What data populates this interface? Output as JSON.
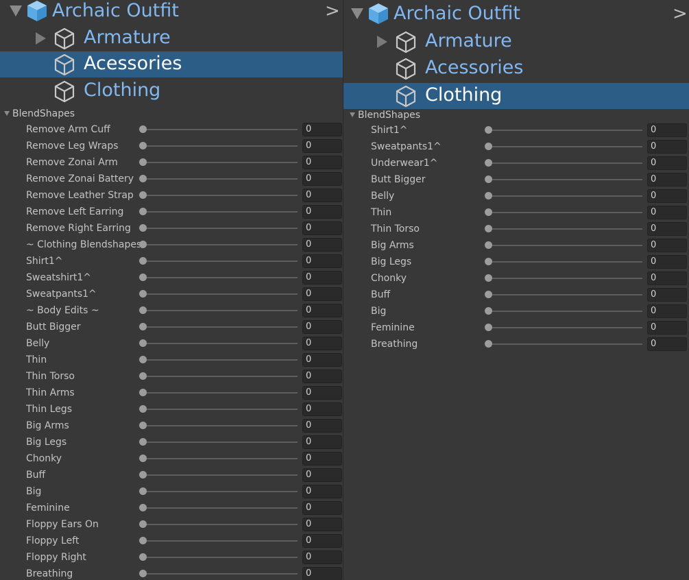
{
  "icon": {
    "cube": "cube-icon",
    "expanded": "triangle-down-icon",
    "collapsed": "triangle-right-icon",
    "chevron": "chevron-right-icon"
  },
  "colors": {
    "background": "#383838",
    "selection": "#2c5d87",
    "prefab_text": "#7fb8f2",
    "field_bg": "#2a2a2a",
    "cube_icon": "#5aaae6"
  },
  "left": {
    "hierarchy": {
      "root": "Archaic Outfit",
      "chevron": ">",
      "children": [
        {
          "label": "Armature",
          "has_children": true,
          "selected": false
        },
        {
          "label": "Acessories",
          "has_children": false,
          "selected": true
        },
        {
          "label": "Clothing",
          "has_children": false,
          "selected": false
        }
      ]
    },
    "blendshapes": {
      "header": "BlendShapes",
      "items": [
        {
          "label": "Remove Arm Cuff",
          "value": "0",
          "level": 0
        },
        {
          "label": "Remove Leg Wraps",
          "value": "0",
          "level": 0
        },
        {
          "label": "Remove Zonai Arm",
          "value": "0",
          "level": 0
        },
        {
          "label": "Remove Zonai Battery",
          "value": "0",
          "level": 0
        },
        {
          "label": "Remove Leather Strap",
          "value": "0",
          "level": 0
        },
        {
          "label": "Remove Left Earring",
          "value": "0",
          "level": 0
        },
        {
          "label": "Remove Right Earring",
          "value": "0",
          "level": 0
        },
        {
          "label": "~ Clothing Blendshapes",
          "value": "0",
          "level": 0
        },
        {
          "label": "Shirt1^",
          "value": "0",
          "level": 0
        },
        {
          "label": "Sweatshirt1^",
          "value": "0",
          "level": 0
        },
        {
          "label": "Sweatpants1^",
          "value": "0",
          "level": 0
        },
        {
          "label": "~ Body Edits ~",
          "value": "0",
          "level": 0
        },
        {
          "label": "Butt Bigger",
          "value": "0",
          "level": 0
        },
        {
          "label": "Belly",
          "value": "0",
          "level": 0
        },
        {
          "label": "Thin",
          "value": "0",
          "level": 0
        },
        {
          "label": "Thin Torso",
          "value": "0",
          "level": 0
        },
        {
          "label": "Thin Arms",
          "value": "0",
          "level": 0
        },
        {
          "label": "Thin Legs",
          "value": "0",
          "level": 0
        },
        {
          "label": "Big Arms",
          "value": "0",
          "level": 0
        },
        {
          "label": "Big Legs",
          "value": "0",
          "level": 0
        },
        {
          "label": "Chonky",
          "value": "0",
          "level": 0
        },
        {
          "label": "Buff",
          "value": "0",
          "level": 0
        },
        {
          "label": "Big",
          "value": "0",
          "level": 0
        },
        {
          "label": "Feminine",
          "value": "0",
          "level": 0
        },
        {
          "label": "Floppy Ears On",
          "value": "0",
          "level": 0
        },
        {
          "label": "Floppy Left",
          "value": "0",
          "level": 0
        },
        {
          "label": "Floppy Right",
          "value": "0",
          "level": 0
        },
        {
          "label": "Breathing",
          "value": "0",
          "level": 0
        }
      ]
    }
  },
  "right": {
    "hierarchy": {
      "root": "Archaic Outfit",
      "chevron": ">",
      "children": [
        {
          "label": "Armature",
          "has_children": true,
          "selected": false
        },
        {
          "label": "Acessories",
          "has_children": false,
          "selected": false
        },
        {
          "label": "Clothing",
          "has_children": false,
          "selected": true
        }
      ]
    },
    "blendshapes": {
      "header": "BlendShapes",
      "items": [
        {
          "label": "Shirt1^",
          "value": "0",
          "level": 0
        },
        {
          "label": "Sweatpants1^",
          "value": "0",
          "level": 0
        },
        {
          "label": "Underwear1^",
          "value": "0",
          "level": 0
        },
        {
          "label": "Butt Bigger",
          "value": "0",
          "level": 0
        },
        {
          "label": "Belly",
          "value": "0",
          "level": 0
        },
        {
          "label": "Thin",
          "value": "0",
          "level": 0
        },
        {
          "label": "Thin Torso",
          "value": "0",
          "level": 0
        },
        {
          "label": "Big Arms",
          "value": "0",
          "level": 0
        },
        {
          "label": "Big Legs",
          "value": "0",
          "level": 0
        },
        {
          "label": "Chonky",
          "value": "0",
          "level": 0
        },
        {
          "label": "Buff",
          "value": "0",
          "level": 0
        },
        {
          "label": "Big",
          "value": "0",
          "level": 0
        },
        {
          "label": "Feminine",
          "value": "0",
          "level": 0
        },
        {
          "label": "Breathing",
          "value": "0",
          "level": 0
        }
      ]
    }
  }
}
